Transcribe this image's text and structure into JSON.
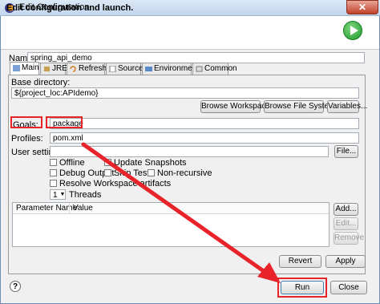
{
  "window": {
    "title": "Edit Configuration",
    "close_glyph": "✕"
  },
  "header": {
    "title": "Edit configuration and launch."
  },
  "name": {
    "label": "Name:",
    "value": "spring_api_demo"
  },
  "tabs": [
    {
      "label": "Main",
      "icon": "main-icon"
    },
    {
      "label": "JRE",
      "icon": "jre-icon"
    },
    {
      "label": "Refresh",
      "icon": "refresh-icon"
    },
    {
      "label": "Source",
      "icon": "source-icon"
    },
    {
      "label": "Environment",
      "icon": "environment-icon"
    },
    {
      "label": "Common",
      "icon": "common-icon"
    }
  ],
  "main": {
    "base_dir_label": "Base directory:",
    "base_dir_value": "${project_loc:APIdemo}",
    "browse_workspace": "Browse Workspace...",
    "browse_filesystem": "Browse File System...",
    "variables": "Variables...",
    "goals_label": "Goals:",
    "goals_value": "package",
    "profiles_label": "Profiles:",
    "profiles_value": "pom.xml",
    "user_settings_label": "User settings:",
    "user_settings_value": "",
    "file_button": "File...",
    "offline": "Offline",
    "update_snapshots": "Update Snapshots",
    "debug_output": "Debug Output",
    "skip_tests": "Skip Tests",
    "non_recursive": "Non-recursive",
    "resolve_workspace": "Resolve Workspace artifacts",
    "threads_value": "1",
    "threads_label": "Threads",
    "table_headers": [
      "Parameter Name",
      "Value"
    ],
    "add_button": "Add...",
    "edit_button": "Edit...",
    "remove_button": "Remove"
  },
  "buttons": {
    "revert": "Revert",
    "apply": "Apply",
    "run": "Run",
    "close": "Close"
  },
  "help_glyph": "?",
  "colors": {
    "highlight": "#e8232a",
    "run_green": "#1c9a2a"
  }
}
